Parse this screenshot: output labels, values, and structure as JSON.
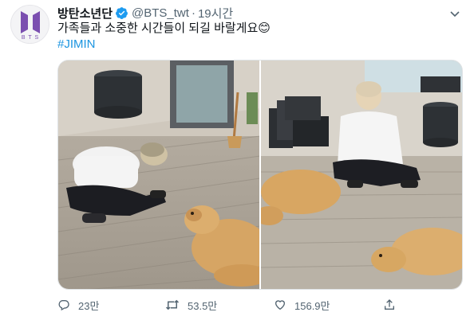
{
  "tweet": {
    "display_name": "방탄소년단",
    "handle": "@BTS_twt",
    "separator": "·",
    "time": "19시간",
    "text": "가족들과 소중한 시간들이 되길 바랄게요😊",
    "hashtag": "#JIMIN",
    "avatar_logo_text": "BTS"
  },
  "actions": {
    "reply_count": "23만",
    "retweet_count": "53.5만",
    "like_count": "156.9만"
  },
  "colors": {
    "verified": "#1d9bf0",
    "hashtag": "#1b95e0",
    "muted": "#536471",
    "avatar_logo": "#7b4fb0"
  },
  "icons": {
    "verified": "verified-badge-icon",
    "menu": "chevron-down-icon",
    "reply": "reply-icon",
    "retweet": "retweet-icon",
    "like": "heart-icon",
    "share": "share-icon"
  }
}
